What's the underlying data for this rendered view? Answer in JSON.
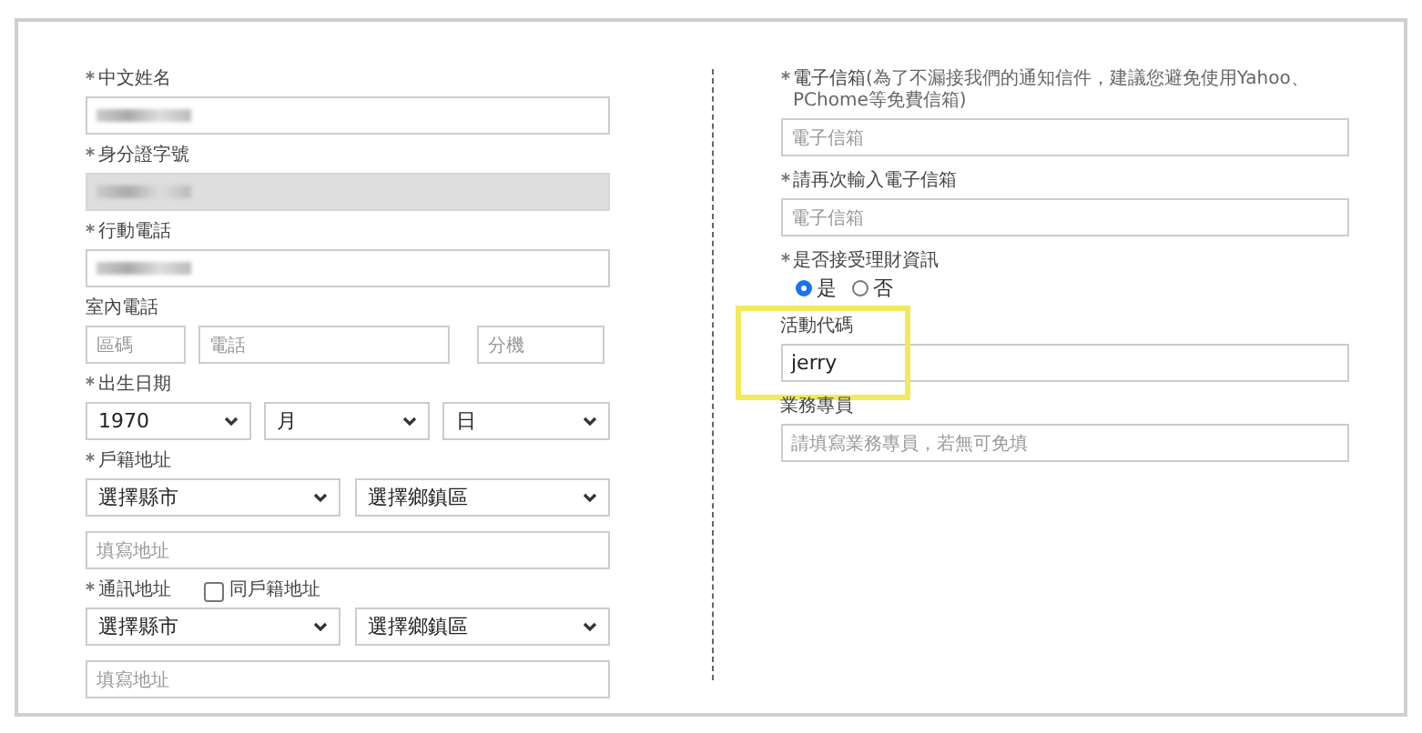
{
  "left": [
    {
      "kind": "text",
      "label": "中文姓名",
      "required": true,
      "redacted": true,
      "disabled": false
    },
    {
      "kind": "text",
      "label": "身分證字號",
      "required": true,
      "redacted": true,
      "disabled": true
    },
    {
      "kind": "text",
      "label": "行動電話",
      "required": true,
      "redacted": true,
      "disabled": false
    },
    {
      "kind": "phone",
      "label": "室內電話",
      "required": false,
      "placeholders": [
        "區碼",
        "電話",
        "分機"
      ]
    },
    {
      "kind": "date",
      "label": "出生日期",
      "required": true,
      "selects": [
        "1970",
        "月",
        "日"
      ]
    },
    {
      "kind": "address",
      "label": "戶籍地址",
      "required": true,
      "selects": [
        "選擇縣市",
        "選擇鄉鎮區"
      ],
      "placeholder": "填寫地址"
    },
    {
      "kind": "address",
      "label": "通訊地址",
      "required": true,
      "checkbox": {
        "label": "同戶籍地址",
        "checked": false
      },
      "selects": [
        "選擇縣市",
        "選擇鄉鎮區"
      ],
      "placeholder": "填寫地址"
    }
  ],
  "right": [
    {
      "kind": "text",
      "label": "電子信箱",
      "required": true,
      "note": "(為了不漏接我們的通知信件，建議您避免使用Yahoo、PChome等免費信箱)",
      "placeholder": "電子信箱"
    },
    {
      "kind": "text",
      "label": "請再次輸入電子信箱",
      "required": true,
      "placeholder": "電子信箱"
    },
    {
      "kind": "radio",
      "label": "是否接受理財資訊",
      "required": true,
      "options": [
        {
          "label": "是",
          "selected": true
        },
        {
          "label": "否",
          "selected": false
        }
      ]
    },
    {
      "kind": "text",
      "label": "活動代碼",
      "required": false,
      "value": "jerry",
      "highlighted": true
    },
    {
      "kind": "text",
      "label": "業務專員",
      "required": false,
      "placeholder": "請填寫業務專員，若無可免填"
    }
  ]
}
